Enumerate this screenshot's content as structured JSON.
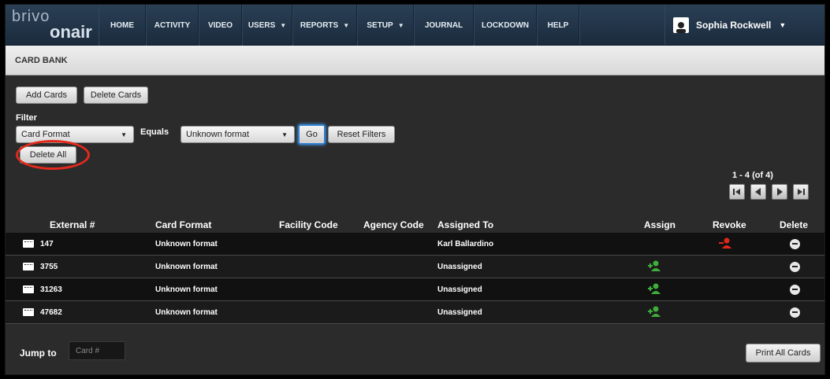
{
  "logo": {
    "brivo": "brivo",
    "onair": "onair"
  },
  "nav": {
    "items": [
      {
        "label": "HOME"
      },
      {
        "label": "ACTIVITY"
      },
      {
        "label": "VIDEO"
      },
      {
        "label": "USERS",
        "caret": "▼"
      },
      {
        "label": "REPORTS",
        "caret": "▼"
      },
      {
        "label": "SETUP",
        "caret": "▼"
      },
      {
        "label": "JOURNAL"
      },
      {
        "label": "LOCKDOWN"
      },
      {
        "label": "HELP"
      }
    ],
    "user_name": "Sophia Rockwell",
    "user_caret": "▼"
  },
  "page": {
    "title": "CARD BANK"
  },
  "toolbar": {
    "add_cards": "Add Cards",
    "delete_cards": "Delete Cards"
  },
  "filter": {
    "label": "Filter",
    "field_value": "Card Format",
    "operator_label": "Equals",
    "value": "Unknown format",
    "go": "Go",
    "reset": "Reset Filters",
    "delete_all": "Delete All"
  },
  "pager": {
    "range": "1 - 4 (of 4)"
  },
  "table": {
    "headers": {
      "external": "External #",
      "format": "Card Format",
      "facility": "Facility Code",
      "agency": "Agency Code",
      "assigned": "Assigned To",
      "assign": "Assign",
      "revoke": "Revoke",
      "delete": "Delete"
    },
    "rows": [
      {
        "external": "147",
        "format": "Unknown format",
        "assigned": "Karl Ballardino",
        "action": "revoke"
      },
      {
        "external": "3755",
        "format": "Unknown format",
        "assigned": "Unassigned",
        "action": "assign"
      },
      {
        "external": "31263",
        "format": "Unknown format",
        "assigned": "Unassigned",
        "action": "assign"
      },
      {
        "external": "47682",
        "format": "Unknown format",
        "assigned": "Unassigned",
        "action": "assign"
      }
    ]
  },
  "footer": {
    "jump_label": "Jump to",
    "jump_placeholder": "Card #",
    "print_all": "Print All Cards"
  },
  "colors": {
    "assign": "#3fae3a",
    "revoke": "#e0281d",
    "highlight": "#e3291c"
  }
}
